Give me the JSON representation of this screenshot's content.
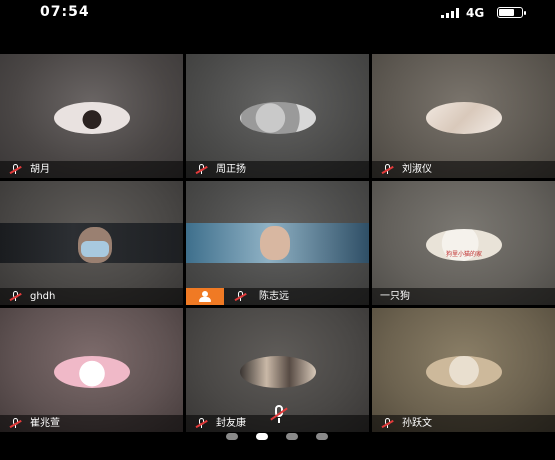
{
  "status_bar": {
    "time": "07:54",
    "network": "4G"
  },
  "participants": [
    {
      "name": "胡月"
    },
    {
      "name": "周正扬"
    },
    {
      "name": "刘淑仪"
    },
    {
      "name": "ghdh"
    },
    {
      "name": "陈志远"
    },
    {
      "name": "一只狗",
      "avatar_text": "狗里小猫的家"
    },
    {
      "name": "崔兆萱"
    },
    {
      "name": "封友康"
    },
    {
      "name": "孙跃文"
    }
  ],
  "pager": {
    "pages": 4,
    "current": 2
  },
  "colors": {
    "host_badge": "#f07a24",
    "muted_slash": "#e23b3b",
    "background": "#000000"
  }
}
